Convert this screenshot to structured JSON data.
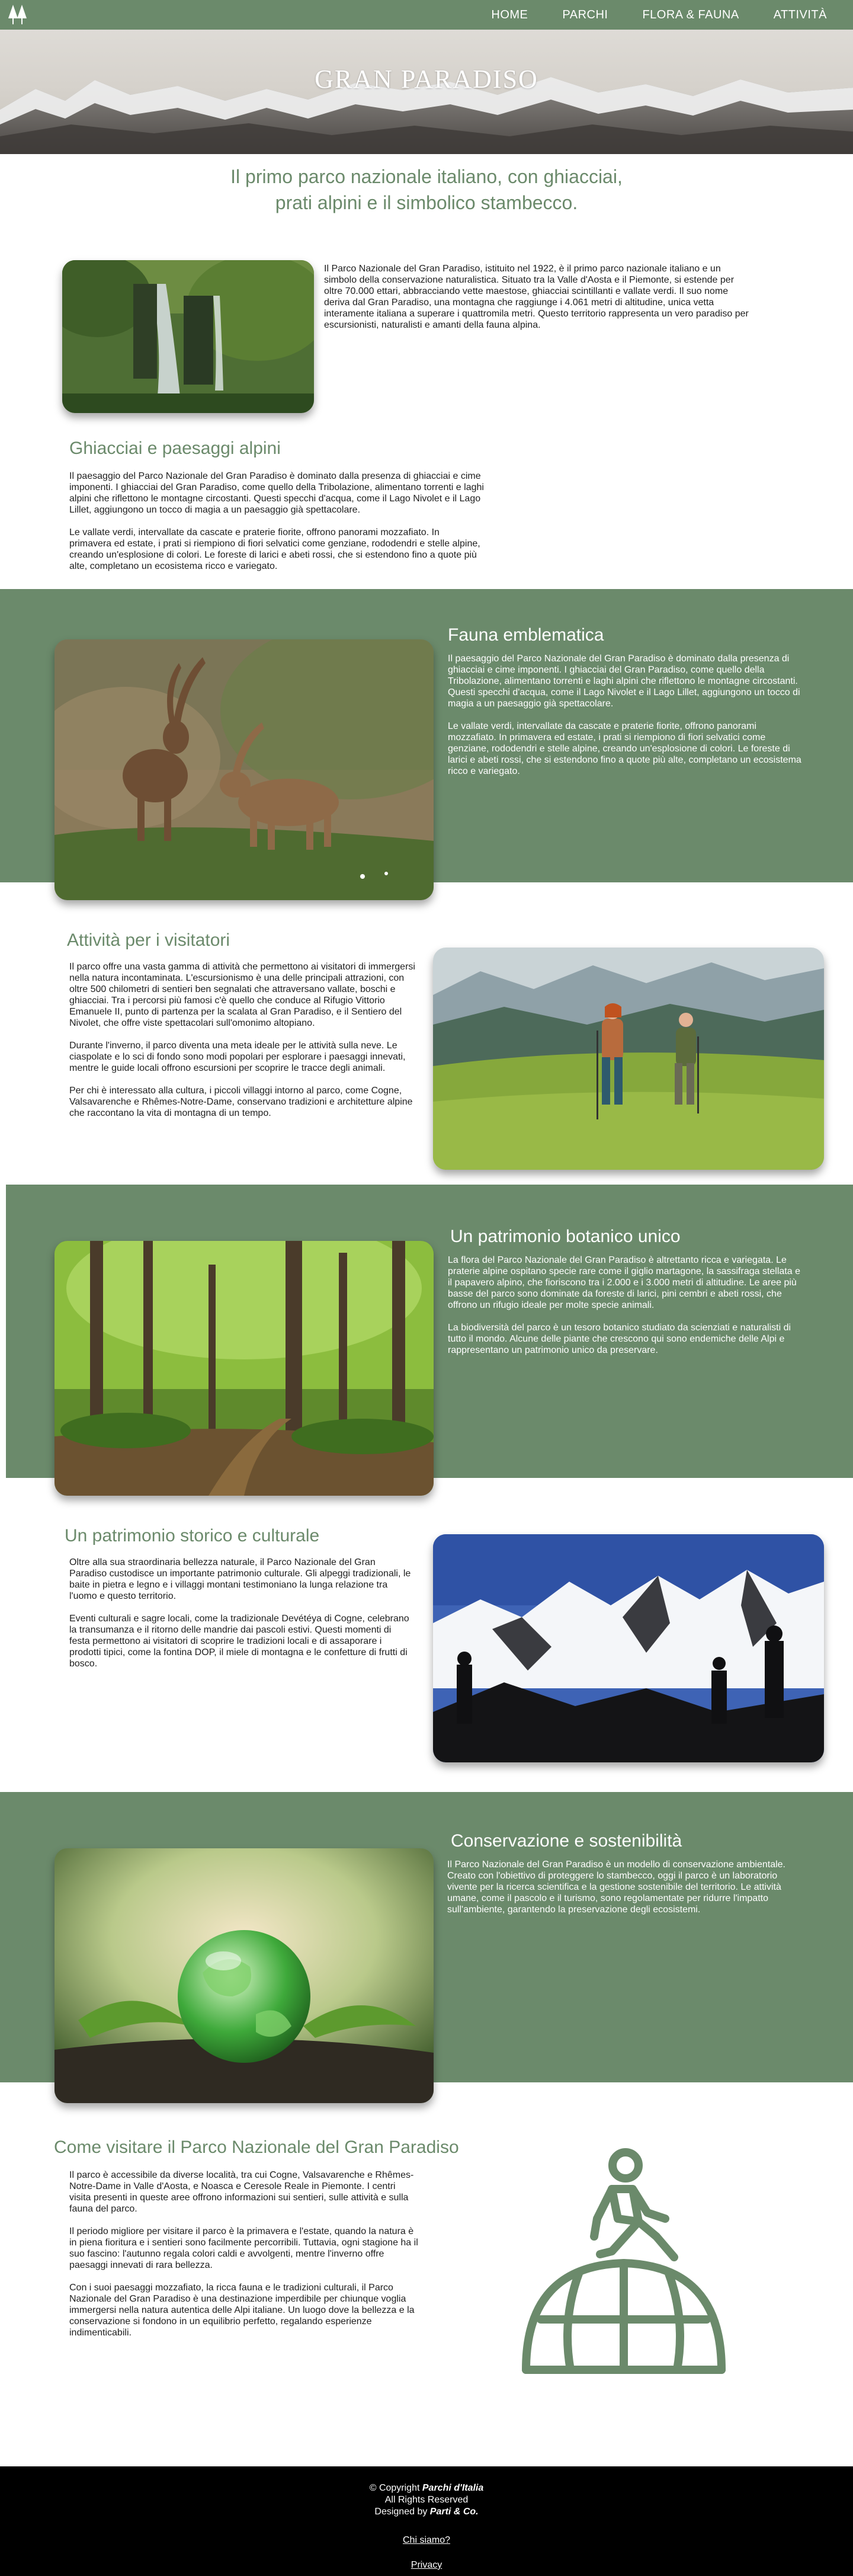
{
  "nav": {
    "logo_icon": "trees-icon",
    "links": [
      "HOME",
      "PARCHI",
      "FLORA & FAUNA",
      "ATTIVITÀ"
    ]
  },
  "hero": {
    "title": "GRAN PARADISO"
  },
  "intro": {
    "line1": "Il primo parco nazionale italiano, con ghiacciai,",
    "line2": "prati alpini e il simbolico stambecco."
  },
  "about": {
    "text": "Il Parco Nazionale del Gran Paradiso, istituito nel 1922, è il primo parco nazionale italiano e un simbolo della conservazione naturalistica. Situato tra la Valle d'Aosta e il Piemonte, si estende per oltre 70.000 ettari, abbracciando vette maestose, ghiacciai scintillanti e vallate verdi. Il suo nome deriva dal Gran Paradiso, una montagna che raggiunge i 4.061 metri di altitudine, unica vetta interamente italiana a superare i quattromila metri. Questo territorio rappresenta un vero paradiso per escursionisti, naturalisti e amanti della fauna alpina."
  },
  "glaciers": {
    "title": "Ghiacciai e paesaggi alpini",
    "p1": "Il paesaggio del Parco Nazionale del Gran Paradiso è dominato dalla presenza di ghiacciai e cime imponenti. I ghiacciai del Gran Paradiso, come quello della Tribolazione, alimentano torrenti e laghi alpini che riflettono le montagne circostanti. Questi specchi d'acqua, come il Lago Nivolet e il Lago Lillet, aggiungono un tocco di magia a un paesaggio già spettacolare.",
    "p2": "Le vallate verdi, intervallate da cascate e praterie fiorite, offrono panorami mozzafiato. In primavera ed estate, i prati si riempiono di fiori selvatici come genziane, rododendri e stelle alpine, creando un'esplosione di colori. Le foreste di larici e abeti rossi, che si estendono fino a quote più alte, completano un ecosistema ricco e variegato."
  },
  "fauna": {
    "title": "Fauna emblematica",
    "p1": "Il paesaggio del Parco Nazionale del Gran Paradiso è dominato dalla presenza di ghiacciai e cime imponenti. I ghiacciai del Gran Paradiso, come quello della Tribolazione, alimentano torrenti e laghi alpini che riflettono le montagne circostanti. Questi specchi d'acqua, come il Lago Nivolet e il Lago Lillet, aggiungono un tocco di magia a un paesaggio già spettacolare.",
    "p2": "Le vallate verdi, intervallate da cascate e praterie fiorite, offrono panorami mozzafiato. In primavera ed estate, i prati si riempiono di fiori selvatici come genziane, rododendri e stelle alpine, creando un'esplosione di colori. Le foreste di larici e abeti rossi, che si estendono fino a quote più alte, completano un ecosistema ricco e variegato."
  },
  "activities": {
    "title": "Attività per i visitatori",
    "p1": "Il parco offre una vasta gamma di attività che permettono ai visitatori di immergersi nella natura incontaminata. L'escursionismo è una delle principali attrazioni, con oltre 500 chilometri di sentieri ben segnalati che attraversano vallate, boschi e ghiacciai. Tra i percorsi più famosi c'è quello che conduce al Rifugio Vittorio Emanuele II, punto di partenza per la scalata al Gran Paradiso, e il Sentiero del Nivolet, che offre viste spettacolari sull'omonimo altopiano.",
    "p2": "Durante l'inverno, il parco diventa una meta ideale per le attività sulla neve. Le ciaspolate e lo sci di fondo sono modi popolari per esplorare i paesaggi innevati, mentre le guide locali offrono escursioni per scoprire le tracce degli animali.",
    "p3": "Per chi è interessato alla cultura, i piccoli villaggi intorno al parco, come Cogne, Valsavarenche e Rhêmes-Notre-Dame, conservano tradizioni e architetture alpine che raccontano la vita di montagna di un tempo."
  },
  "botany": {
    "title": "Un patrimonio botanico unico",
    "p1": "La flora del Parco Nazionale del Gran Paradiso è altrettanto ricca e variegata. Le praterie alpine ospitano specie rare come il giglio martagone, la sassifraga stellata e il papavero alpino, che fioriscono tra i 2.000 e i 3.000 metri di altitudine. Le aree più basse del parco sono dominate da foreste di larici, pini cembri e abeti rossi, che offrono un rifugio ideale per molte specie animali.",
    "p2": "La biodiversità del parco è un tesoro botanico studiato da scienziati e naturalisti di tutto il mondo. Alcune delle piante che crescono qui sono endemiche delle Alpi e rappresentano un patrimonio unico da preservare."
  },
  "history": {
    "title": "Un patrimonio storico e culturale",
    "p1": "Oltre alla sua straordinaria bellezza naturale, il Parco Nazionale del Gran Paradiso custodisce un importante patrimonio culturale. Gli alpeggi tradizionali, le baite in pietra e legno e i villaggi montani testimoniano la lunga relazione tra l'uomo e questo territorio.",
    "p2": "Eventi culturali e sagre locali, come la tradizionale Devétéya di Cogne, celebrano la transumanza e il ritorno delle mandrie dai pascoli estivi. Questi momenti di festa permettono ai visitatori di scoprire le tradizioni locali e di assaporare i prodotti tipici, come la fontina DOP, il miele di montagna e le confetture di frutti di bosco."
  },
  "conservation": {
    "title": "Conservazione e sostenibilità",
    "p1": "Il Parco Nazionale del Gran Paradiso è un modello di conservazione ambientale. Creato con l'obiettivo di proteggere lo stambecco, oggi il parco è un laboratorio vivente per la ricerca scientifica e la gestione sostenibile del territorio. Le attività umane, come il pascolo e il turismo, sono regolamentate per ridurre l'impatto sull'ambiente, garantendo la preservazione degli ecosistemi."
  },
  "visit": {
    "title": "Come visitare il Parco Nazionale del Gran Paradiso",
    "p1": "Il parco è accessibile da diverse località, tra cui Cogne, Valsavarenche e Rhêmes-Notre-Dame in Valle d'Aosta, e Noasca e Ceresole Reale in Piemonte. I centri visita presenti in queste aree offrono informazioni sui sentieri, sulle attività e sulla fauna del parco.",
    "p2": "Il periodo migliore per visitare il parco è la primavera e l'estate, quando la natura è in piena fioritura e i sentieri sono facilmente percorribili. Tuttavia, ogni stagione ha il suo fascino: l'autunno regala colori caldi e avvolgenti, mentre l'inverno offre paesaggi innevati di rara bellezza.",
    "p3": "Con i suoi paesaggi mozzafiato, la ricca fauna e le tradizioni culturali, il Parco Nazionale del Gran Paradiso è una destinazione imperdibile per chiunque voglia immergersi nella natura autentica delle Alpi italiane. Un luogo dove la bellezza e la conservazione si fondono in un equilibrio perfetto, regalando esperienze indimenticabili.",
    "icon": "hiker-on-globe-icon"
  },
  "footer": {
    "copyright_prefix": "© Copyright",
    "brand": "Parchi d'Italia",
    "rights": "All Rights Reserved",
    "designed_prefix": "Designed by",
    "designer": "Parti & Co.",
    "link_about": "Chi siamo?",
    "link_privacy": "Privacy"
  },
  "colors": {
    "accent_green": "#6b8a6b",
    "footer_bg": "#000000"
  }
}
